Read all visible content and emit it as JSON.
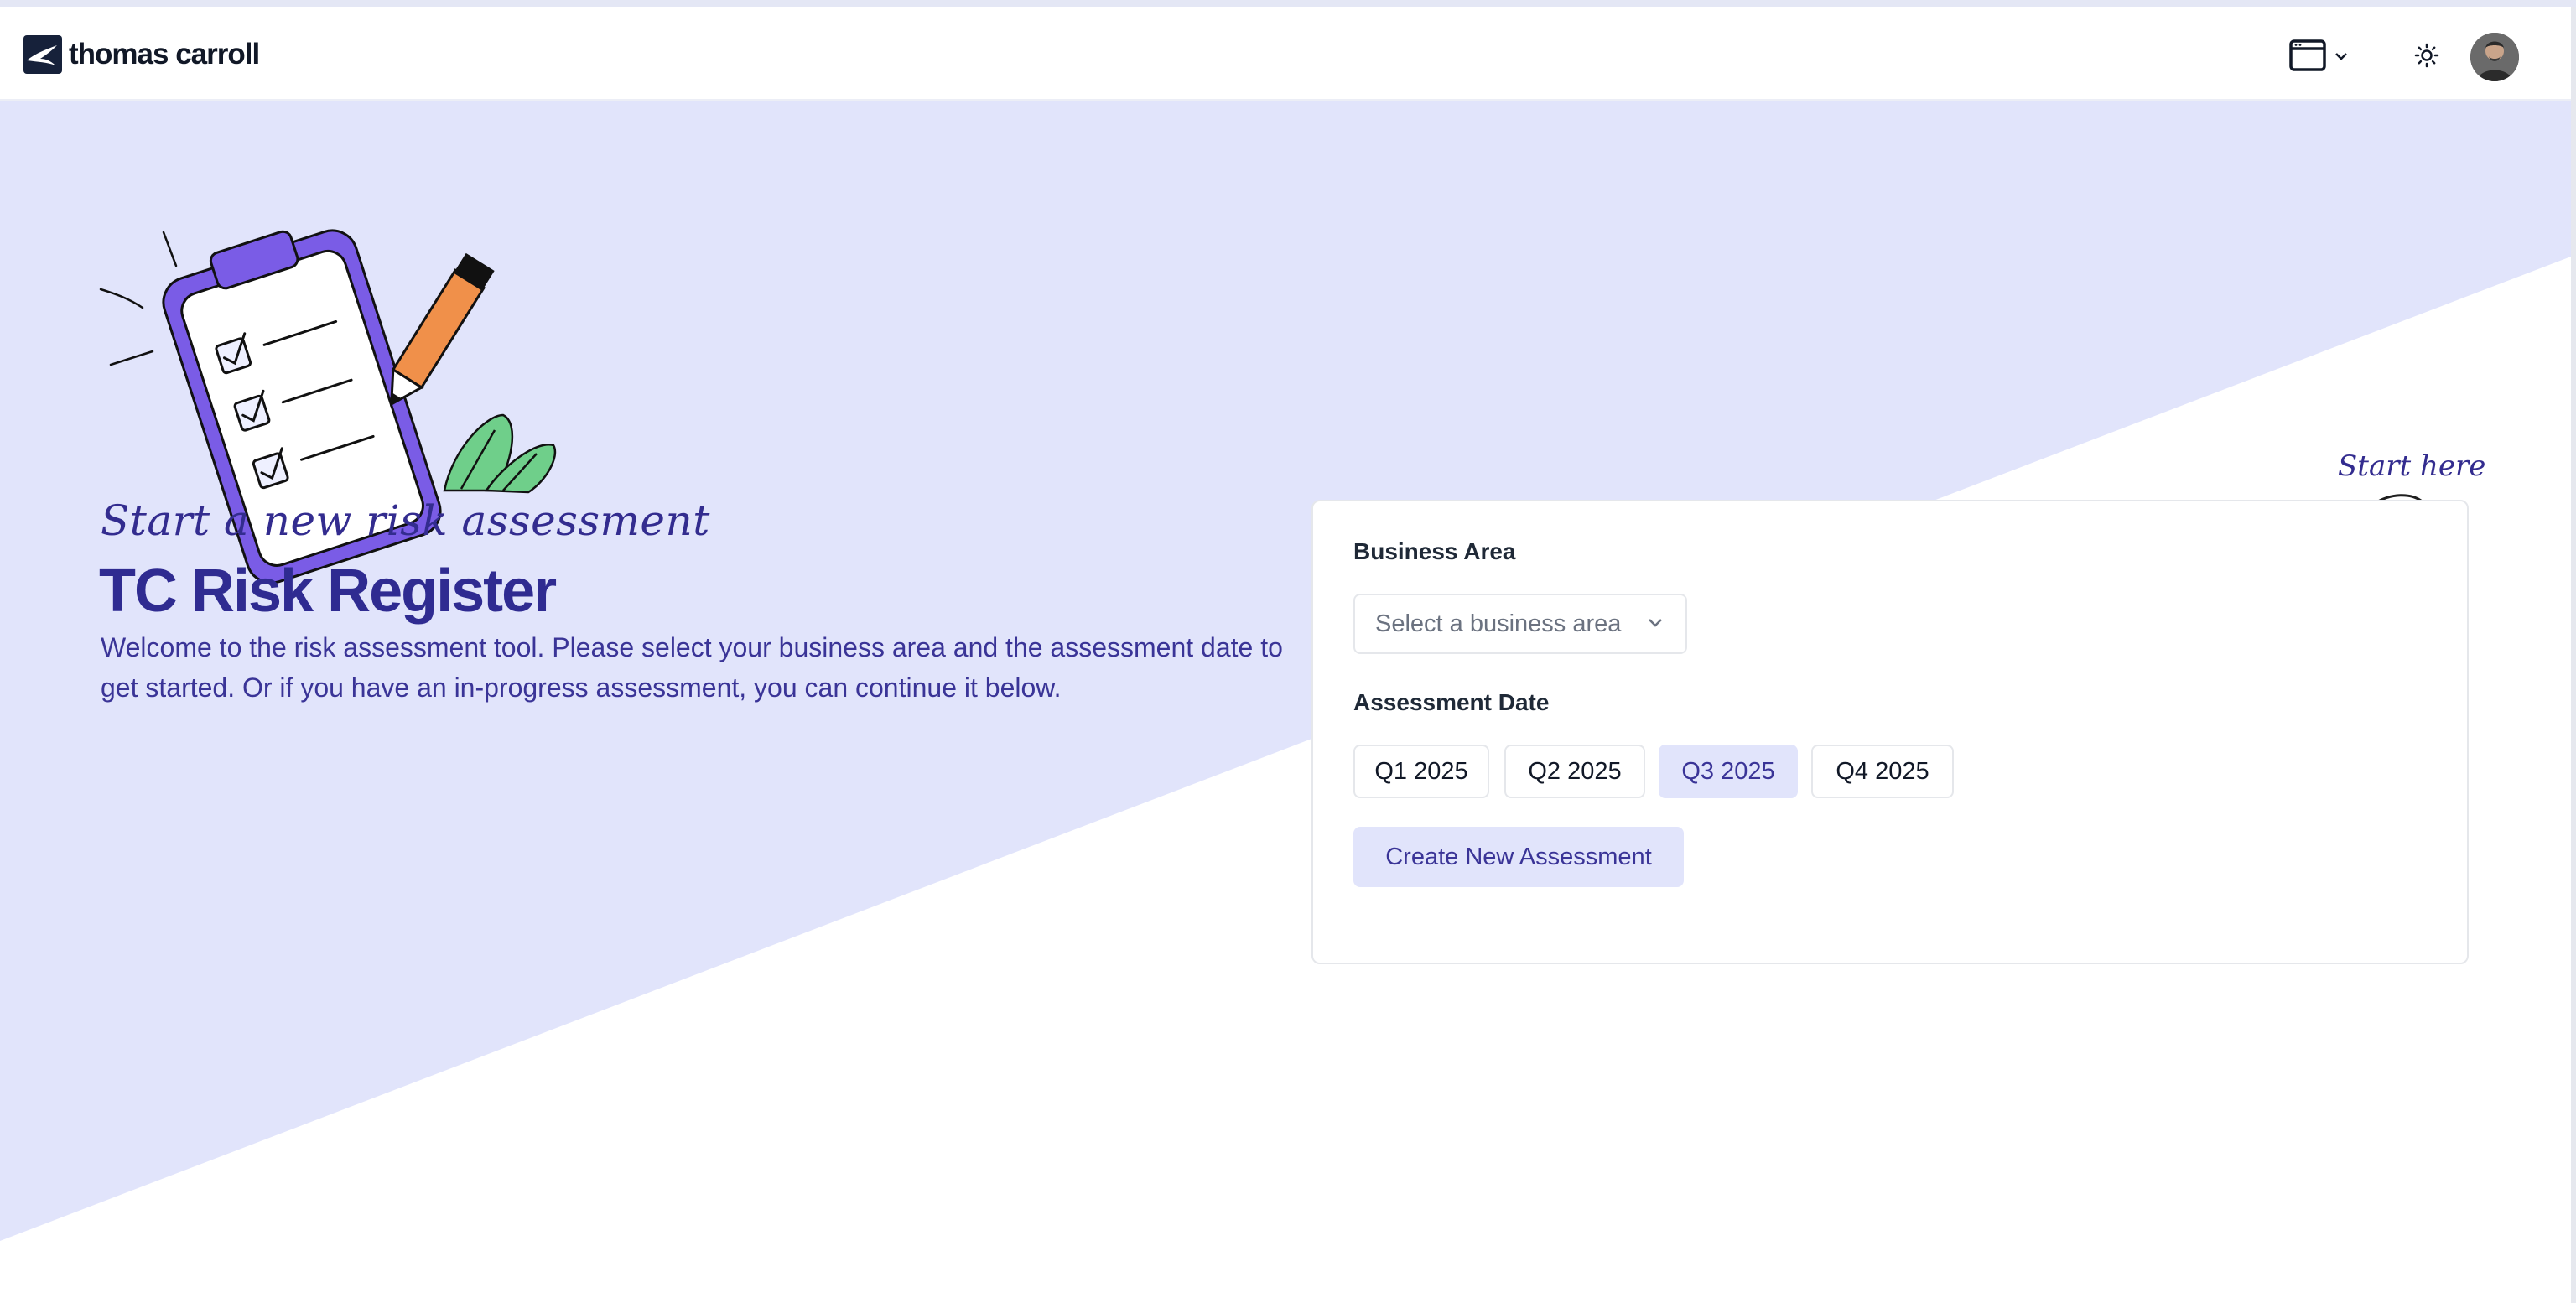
{
  "header": {
    "brand_name": "thomas carroll",
    "icons": {
      "brand": "bird-logo-icon",
      "browser": "browser-window-icon",
      "dropdown": "chevron-down-icon",
      "theme": "sun-icon",
      "avatar": "user-avatar"
    }
  },
  "hero": {
    "kicker": "Start a new risk assessment",
    "title": "TC Risk Register",
    "intro": "Welcome to the risk assessment tool. Please select your business area and the assessment date to get started. Or if you have an in-progress assessment, you can continue it below.",
    "illustration": "clipboard-checklist-illustration"
  },
  "form": {
    "business_area_label": "Business Area",
    "business_area_placeholder": "Select a business area",
    "assessment_date_label": "Assessment Date",
    "quarters": [
      "Q1 2025",
      "Q2 2025",
      "Q3 2025",
      "Q4 2025"
    ],
    "selected_quarter": "Q3 2025",
    "create_label": "Create New Assessment"
  },
  "callout": {
    "start_here": "Start here"
  },
  "colors": {
    "accent": "#2f2b91",
    "hero_bg": "#e1e4fb",
    "selected_bg": "#e1e4fb"
  }
}
